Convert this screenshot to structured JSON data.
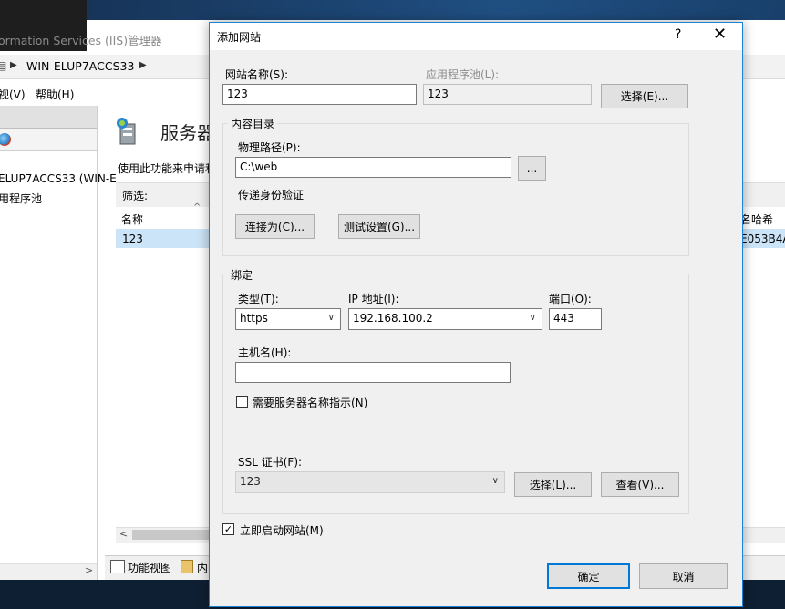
{
  "background": {
    "window_title": "ormation Services (IIS)管理器",
    "address": "WIN-ELUP7ACCS33",
    "menu": {
      "view": "视(V)",
      "help": "帮助(H)"
    },
    "tree": {
      "server": "ELUP7ACCS33 (WIN-E",
      "app_pools": "用程序池"
    },
    "heading": "服务器",
    "description": "使用此功能来申请和",
    "filter_label": "筛选:",
    "column_name": "名称",
    "column_hash": "名哈希",
    "row_name": "123",
    "row_hash": "E053B4A",
    "bottom_tabs": {
      "features_view": "功能视图",
      "content_view": "内"
    }
  },
  "dialog": {
    "title": "添加网站",
    "help": "?",
    "close": "✕",
    "site_name_label": "网站名称(S):",
    "site_name_value": "123",
    "app_pool_label": "应用程序池(L):",
    "app_pool_value": "123",
    "select_pool_button": "选择(E)...",
    "content_dir": {
      "group_label": "内容目录",
      "physical_path_label": "物理路径(P):",
      "physical_path_value": "C:\\web",
      "browse_button": "...",
      "pass_through_auth_label": "传递身份验证",
      "connect_as_button": "连接为(C)...",
      "test_settings_button": "测试设置(G)..."
    },
    "binding": {
      "group_label": "绑定",
      "type_label": "类型(T):",
      "type_value": "https",
      "ip_label": "IP 地址(I):",
      "ip_value": "192.168.100.2",
      "port_label": "端口(O):",
      "port_value": "443",
      "hostname_label": "主机名(H):",
      "hostname_value": "",
      "sni_label": "需要服务器名称指示(N)",
      "sni_checked": false,
      "ssl_label": "SSL 证书(F):",
      "ssl_value": "123",
      "ssl_select_button": "选择(L)...",
      "ssl_view_button": "查看(V)..."
    },
    "start_immediately_label": "立即启动网站(M)",
    "start_immediately_checked": true,
    "ok_button": "确定",
    "cancel_button": "取消"
  }
}
